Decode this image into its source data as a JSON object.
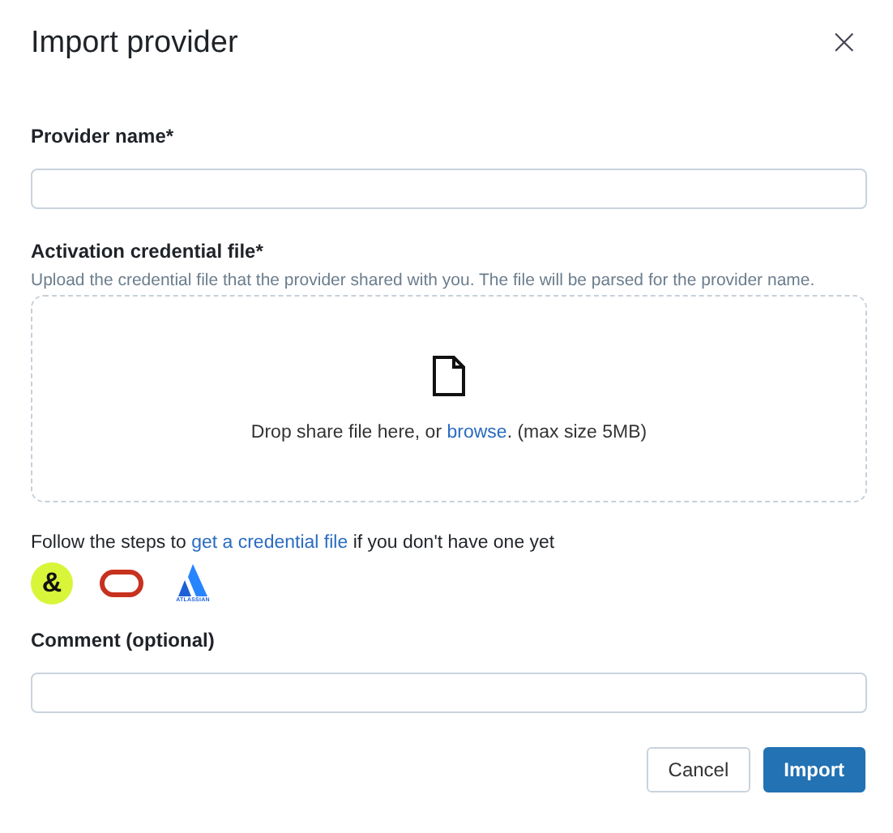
{
  "dialog": {
    "title": "Import provider",
    "close": "×"
  },
  "provider_name": {
    "label": "Provider name*"
  },
  "credential_file": {
    "label": "Activation credential file*",
    "help": "Upload the credential file that the provider shared with you. The file will be parsed for the provider name.",
    "drop_before": "Drop share file here, or ",
    "drop_link": "browse",
    "drop_after": ". (max size 5MB)"
  },
  "steps": {
    "before": "Follow the steps to ",
    "link": "get a credential file",
    "after": " if you don't have one yet"
  },
  "logos": [
    {
      "kind": "ampersand",
      "text": "&"
    },
    {
      "kind": "ring"
    },
    {
      "kind": "atlassian",
      "text": "ATLASSIAN"
    }
  ],
  "comment": {
    "label": "Comment (optional)"
  },
  "buttons": [
    {
      "label": "Cancel",
      "kind": "secondary"
    },
    {
      "label": "Import",
      "kind": "primary"
    }
  ]
}
